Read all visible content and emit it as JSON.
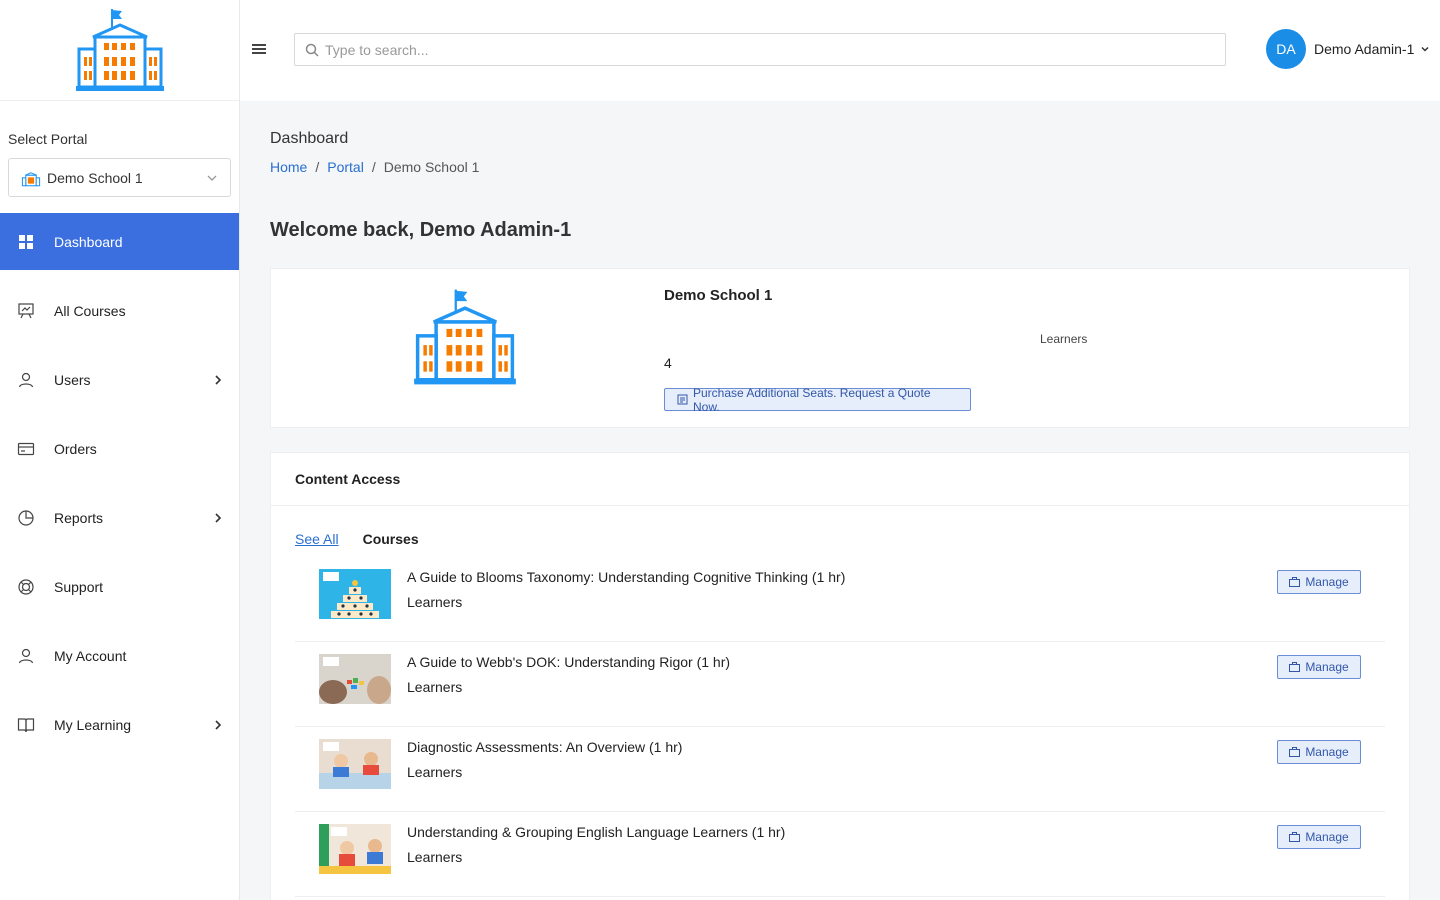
{
  "sidebar": {
    "select_label": "Select Portal",
    "portal_value": "Demo School 1",
    "items": [
      {
        "label": "Dashboard",
        "icon": "dashboard-icon"
      },
      {
        "label": "All Courses",
        "icon": "courses-icon"
      },
      {
        "label": "Users",
        "icon": "user-icon"
      },
      {
        "label": "Orders",
        "icon": "orders-icon"
      },
      {
        "label": "Reports",
        "icon": "reports-icon"
      },
      {
        "label": "Support",
        "icon": "support-icon"
      },
      {
        "label": "My Account",
        "icon": "account-icon"
      },
      {
        "label": "My Learning",
        "icon": "book-icon"
      }
    ]
  },
  "topbar": {
    "search_placeholder": "Type to search...",
    "avatar_initials": "DA",
    "user_name": "Demo Adamin-1"
  },
  "page": {
    "title": "Dashboard",
    "breadcrumb": [
      "Home",
      "Portal",
      "Demo School 1"
    ],
    "welcome": "Welcome back, Demo Adamin-1"
  },
  "school_card": {
    "name": "Demo School 1",
    "learners_label": "Learners",
    "count": "4",
    "quote_button": "Purchase Additional Seats. Request a Quote Now."
  },
  "content_access": {
    "heading": "Content Access",
    "see_all": "See All",
    "tab": "Courses",
    "courses": [
      {
        "title": "A Guide to Blooms Taxonomy: Understanding Cognitive Thinking (1 hr)",
        "sub": "Learners",
        "manage": "Manage"
      },
      {
        "title": "A Guide to Webb's DOK: Understanding Rigor (1 hr)",
        "sub": "Learners",
        "manage": "Manage"
      },
      {
        "title": "Diagnostic Assessments: An Overview (1 hr)",
        "sub": "Learners",
        "manage": "Manage"
      },
      {
        "title": "Understanding & Grouping English Language Learners (1 hr)",
        "sub": "Learners",
        "manage": "Manage"
      }
    ]
  },
  "colors": {
    "accent": "#3b6fe0",
    "avatar": "#1a8de6",
    "logo_blue": "#2196f3",
    "logo_orange": "#f57c00"
  }
}
